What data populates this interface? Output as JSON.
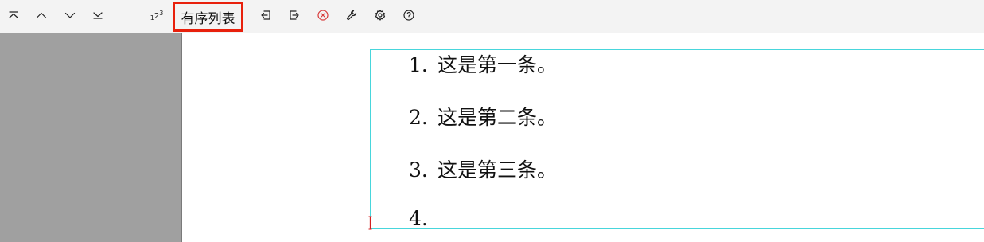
{
  "toolbar": {
    "ordered_list_label": "有序列表",
    "number_format_icon": {
      "base": "1",
      "sub": "2",
      "sup": "3"
    },
    "buttons": [
      {
        "name": "move-to-top-icon"
      },
      {
        "name": "move-up-icon"
      },
      {
        "name": "move-down-icon"
      },
      {
        "name": "move-to-bottom-icon"
      },
      {
        "name": "outdent-icon"
      },
      {
        "name": "indent-icon"
      },
      {
        "name": "remove-list-icon",
        "color": "#d83a3a"
      },
      {
        "name": "wrench-icon"
      },
      {
        "name": "gear-icon"
      },
      {
        "name": "help-icon"
      }
    ]
  },
  "document": {
    "list": [
      {
        "number": "1.",
        "text": "这是第一条。"
      },
      {
        "number": "2.",
        "text": "这是第二条。"
      },
      {
        "number": "3.",
        "text": "这是第三条。"
      },
      {
        "number": "4.",
        "text": ""
      }
    ]
  },
  "colors": {
    "highlight_border": "#e8200c",
    "selection_border": "#47d6dc",
    "caret": "#d42020",
    "left_panel": "#a0a0a0",
    "toolbar_bg": "#f3f3f3"
  }
}
